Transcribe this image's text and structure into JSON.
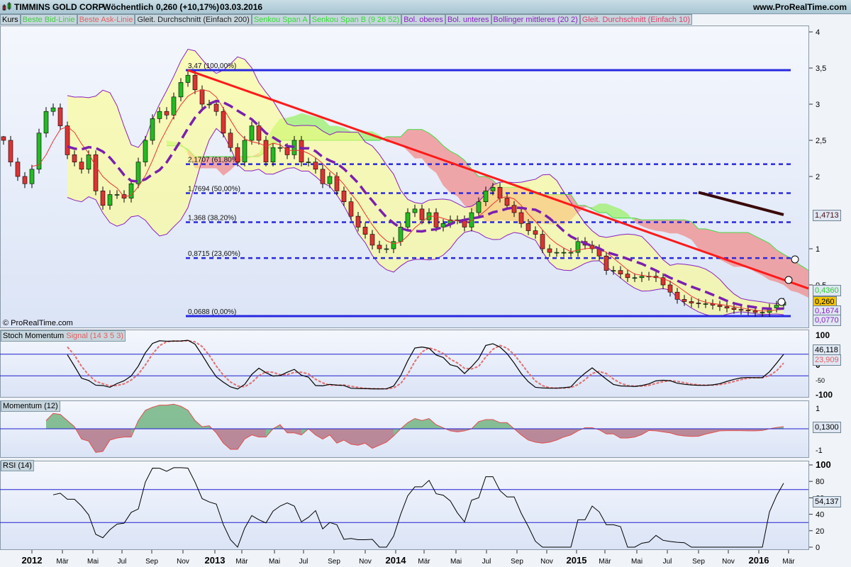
{
  "header": {
    "symbol": "TIMMINS GOLD CORP",
    "period": "Wöchentlich",
    "quote": "0,260 (+10,17%)",
    "date": "03.03.2016",
    "site": "www.ProRealTime.com"
  },
  "legend": [
    {
      "label": "Kurs",
      "color": "#000000"
    },
    {
      "label": "Beste Bid-Linie",
      "color": "#44cc44"
    },
    {
      "label": "Beste Ask-Linie",
      "color": "#e06060"
    },
    {
      "label": "Gleit. Durchschnitt (Einfach 200)",
      "color": "#222222"
    },
    {
      "label": "Senkou Span A",
      "color": "#33dd33"
    },
    {
      "label": "Senkou Span B (9 26 52)",
      "color": "#33dd33"
    },
    {
      "label": "Bol. oberes",
      "color": "#8a1fc0"
    },
    {
      "label": "Bol. unteres",
      "color": "#8a1fc0"
    },
    {
      "label": "Bollinger mittleres (20 2)",
      "color": "#8a1fc0"
    },
    {
      "label": "Gleit. Durchschnitt (Einfach 10)",
      "color": "#e0406a"
    }
  ],
  "copyright": "© ProRealTime.com",
  "panels": {
    "stoch": {
      "label": "Stoch Momentum",
      "signal_label": "Signal (14 3 5 3)",
      "value": "46,118",
      "signal_value": "23,909",
      "ticks": [
        "100",
        "50",
        "0",
        "-50",
        "-100"
      ]
    },
    "momentum": {
      "label": "Momentum (12)",
      "value": "0,1300",
      "ticks": [
        "1",
        "-1"
      ]
    },
    "rsi": {
      "label": "RSI (14)",
      "value": "54,137",
      "ticks": [
        "100",
        "80",
        "60",
        "40",
        "20",
        "0"
      ]
    }
  },
  "price_axis": {
    "ticks": [
      "4",
      "3,5",
      "3",
      "2,5",
      "2",
      "1",
      "0,5"
    ],
    "labels": {
      "ma200": "1,4713",
      "span": "0,4360",
      "last": "0,260",
      "bol_mid": "0,1674",
      "bol_low": "0,0770"
    }
  },
  "time_axis": [
    "2012",
    "Mär",
    "Mai",
    "Jul",
    "Sep",
    "Nov",
    "2013",
    "Mär",
    "Mai",
    "Jul",
    "Sep",
    "Nov",
    "2014",
    "Mär",
    "Mai",
    "Jul",
    "Sep",
    "Nov",
    "2015",
    "Mär",
    "Mai",
    "Jul",
    "Sep",
    "Nov",
    "2016",
    "Mär"
  ],
  "chart_data": {
    "type": "candlestick",
    "title": "TIMMINS GOLD CORP Wöchentlich",
    "xlabel": "",
    "ylabel": "",
    "ylim": [
      0,
      4.2
    ],
    "x_unit": "bi-weekly bar index (Dec 2011 – Mar 2016)",
    "closes": [
      2.5,
      2.2,
      2.0,
      1.9,
      2.1,
      2.6,
      2.9,
      2.95,
      2.7,
      2.3,
      2.2,
      2.1,
      2.3,
      1.8,
      1.6,
      1.75,
      1.75,
      1.7,
      1.9,
      2.2,
      2.5,
      2.8,
      2.9,
      2.85,
      3.1,
      3.3,
      3.4,
      3.2,
      3.0,
      3.0,
      2.9,
      2.6,
      2.4,
      2.2,
      2.5,
      2.7,
      2.5,
      2.2,
      2.4,
      2.4,
      2.3,
      2.5,
      2.2,
      2.2,
      2.1,
      1.9,
      2.0,
      1.8,
      1.65,
      1.45,
      1.3,
      1.2,
      1.05,
      1.0,
      1.0,
      1.1,
      1.3,
      1.5,
      1.55,
      1.4,
      1.5,
      1.3,
      1.35,
      1.4,
      1.4,
      1.3,
      1.5,
      1.65,
      1.8,
      1.85,
      1.7,
      1.6,
      1.5,
      1.35,
      1.25,
      1.2,
      1.0,
      0.95,
      0.95,
      0.95,
      0.95,
      1.1,
      1.05,
      1.0,
      0.9,
      0.7,
      0.7,
      0.65,
      0.6,
      0.6,
      0.62,
      0.62,
      0.6,
      0.5,
      0.4,
      0.3,
      0.27,
      0.25,
      0.24,
      0.24,
      0.22,
      0.2,
      0.18,
      0.16,
      0.15,
      0.14,
      0.12,
      0.12,
      0.18,
      0.22,
      0.26
    ],
    "fibonacci": [
      {
        "value": 3.47,
        "label": "3,47 (100,00%)"
      },
      {
        "value": 2.1707,
        "label": "2,1707 (61,80%)"
      },
      {
        "value": 1.7694,
        "label": "1,7694 (50,00%)"
      },
      {
        "value": 1.368,
        "label": "1,368 (38,20%)"
      },
      {
        "value": 0.8715,
        "label": "0,8715 (23,60%)"
      },
      {
        "value": 0.0688,
        "label": "0,0688 (0,00%)"
      }
    ],
    "trendline": {
      "start_index": 26,
      "start_value": 3.47,
      "end_index": 113.5,
      "end_value": 0.45
    },
    "ma200": {
      "start_index": 98,
      "start_value": 1.78,
      "end_index": 110,
      "end_value": 1.4713
    },
    "stoch_levels": [
      40,
      -40
    ],
    "momentum_levels": [
      0
    ],
    "rsi_levels": [
      70,
      30
    ]
  }
}
